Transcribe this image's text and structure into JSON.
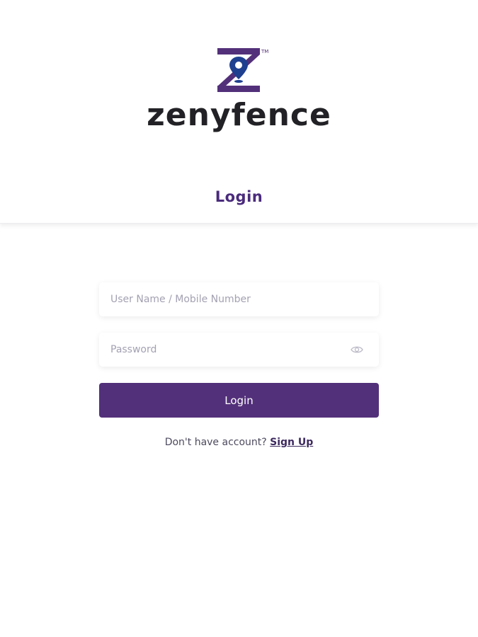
{
  "brand": {
    "name": "zenyfence",
    "trademark": "TM",
    "logo_icon": "z-location-pin-icon",
    "primary_color": "#53307a",
    "pin_color": "#1f3f8f"
  },
  "header": {
    "title": "Login"
  },
  "form": {
    "username": {
      "placeholder": "User Name / Mobile Number",
      "value": ""
    },
    "password": {
      "placeholder": "Password",
      "value": "",
      "toggle_icon": "eye-icon"
    },
    "login_label": "Login",
    "signup_prompt": "Don't have account?",
    "signup_label": "Sign Up"
  }
}
